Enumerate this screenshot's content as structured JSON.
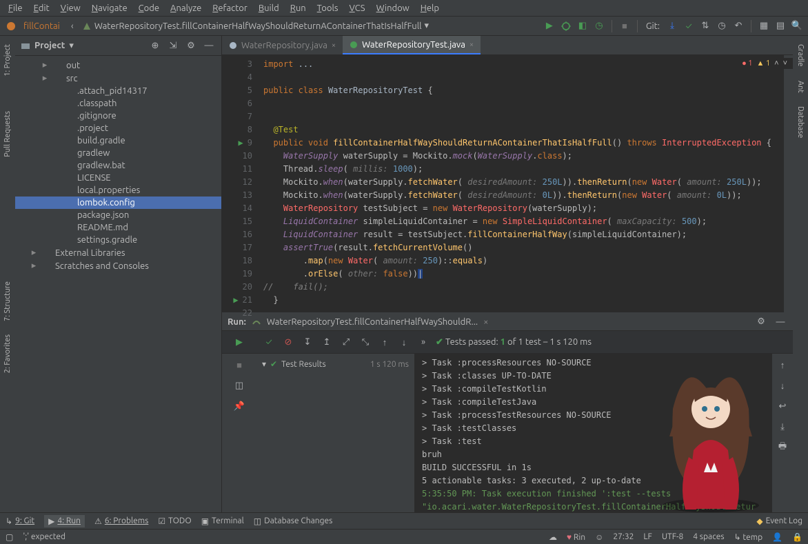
{
  "menu": [
    "File",
    "Edit",
    "View",
    "Navigate",
    "Code",
    "Analyze",
    "Refactor",
    "Build",
    "Run",
    "Tools",
    "VCS",
    "Window",
    "Help"
  ],
  "toolbar": {
    "run_config_short": "fillContai",
    "breadcrumb": "WaterRepositoryTest.fillContainerHalfWayShouldReturnAContainerThatIsHalfFull",
    "git_label": "Git:"
  },
  "left_tool_tabs": [
    "1: Project",
    "Pull Requests"
  ],
  "right_tool_tabs": [
    "Gradle",
    "Ant",
    "Database"
  ],
  "project": {
    "title": "Project",
    "items": [
      {
        "label": "out",
        "indent": 2,
        "exp": "▸",
        "icon": "folder"
      },
      {
        "label": "src",
        "indent": 2,
        "exp": "▸",
        "icon": "folder-src"
      },
      {
        "label": ".attach_pid14317",
        "indent": 3,
        "icon": "file"
      },
      {
        "label": ".classpath",
        "indent": 3,
        "icon": "eclipse"
      },
      {
        "label": ".gitignore",
        "indent": 3,
        "icon": "file"
      },
      {
        "label": ".project",
        "indent": 3,
        "icon": "eclipse"
      },
      {
        "label": "build.gradle",
        "indent": 3,
        "icon": "gradle"
      },
      {
        "label": "gradlew",
        "indent": 3,
        "icon": "file"
      },
      {
        "label": "gradlew.bat",
        "indent": 3,
        "icon": "file"
      },
      {
        "label": "LICENSE",
        "indent": 3,
        "icon": "file"
      },
      {
        "label": "local.properties",
        "indent": 3,
        "icon": "props"
      },
      {
        "label": "lombok.config",
        "indent": 3,
        "icon": "file",
        "sel": true
      },
      {
        "label": "package.json",
        "indent": 3,
        "icon": "json"
      },
      {
        "label": "README.md",
        "indent": 3,
        "icon": "md"
      },
      {
        "label": "settings.gradle",
        "indent": 3,
        "icon": "gradle"
      },
      {
        "label": "External Libraries",
        "indent": 1,
        "exp": "▸",
        "icon": "lib"
      },
      {
        "label": "Scratches and Consoles",
        "indent": 1,
        "exp": "▸",
        "icon": "scratch"
      }
    ]
  },
  "editor": {
    "tabs": [
      {
        "label": "WaterRepository.java",
        "active": false
      },
      {
        "label": "WaterRepositoryTest.java",
        "active": true
      }
    ],
    "errors": "1",
    "warnings": "1",
    "first_line_no": 3,
    "lines": [
      {
        "html": "<span class='kw'>import</span> <span class='type'>...</span>"
      },
      {
        "html": ""
      },
      {
        "html": "<span class='kw'>public class</span> <span class='cls'>WaterRepositoryTest</span> {"
      },
      {
        "html": ""
      },
      {
        "html": ""
      },
      {
        "html": "  <span class='an'>@Test</span>"
      },
      {
        "html": "  <span class='kw'>public void</span> <span class='fn'>fillContainerHalfWayShouldReturnAContainerThatIsHalfFull</span>() <span class='kw'>throws</span> <span class='err'>InterruptedException</span> {",
        "run": true
      },
      {
        "html": "    <span class='it'>WaterSupply</span> waterSupply = Mockito.<span class='it'>mock</span>(<span class='it'>WaterSupply</span>.<span class='kw'>class</span>);"
      },
      {
        "html": "    Thread.<span class='it'>sleep</span>( <span class='hint'>millis:</span> <span class='num'>1000</span>);"
      },
      {
        "html": "    Mockito.<span class='it'>when</span>(waterSupply.<span class='fn'>fetchWater</span>( <span class='hint'>desiredAmount:</span> <span class='num'>250L</span>)).<span class='fn'>thenReturn</span>(<span class='kw'>new</span> <span class='err'>Water</span>( <span class='hint'>amount:</span> <span class='num'>250L</span>));"
      },
      {
        "html": "    Mockito.<span class='it'>when</span>(waterSupply.<span class='fn'>fetchWater</span>( <span class='hint'>desiredAmount:</span> <span class='num'>0L</span>)).<span class='fn'>thenReturn</span>(<span class='kw'>new</span> <span class='err'>Water</span>( <span class='hint'>amount:</span> <span class='num'>0L</span>));"
      },
      {
        "html": "    <span class='err'>WaterRepository</span> testSubject = <span class='kw'>new</span> <span class='err'>WaterRepository</span>(waterSupply);"
      },
      {
        "html": "    <span class='it'>LiquidContainer</span> simpleLiquidContainer = <span class='kw'>new</span> <span class='err'>SimpleLiquidContainer</span>( <span class='hint'>maxCapacity:</span> <span class='num'>500</span>);"
      },
      {
        "html": "    <span class='it'>LiquidContainer</span> result = testSubject.<span class='fn'>fillContainerHalfWay</span>(simpleLiquidContainer);"
      },
      {
        "html": "    <span class='it'>assertTrue</span>(result.<span class='fn'>fetchCurrentVolume</span>()"
      },
      {
        "html": "        .<span class='fn'>map</span>(<span class='kw'>new</span> <span class='err'>Water</span>( <span class='hint'>amount:</span> <span class='num'>250</span>)::<span class='fn'>equals</span>)"
      },
      {
        "html": "        .<span class='fn'>orElse</span>( <span class='hint'>other:</span> <span class='kw'>false</span>))<span style='background:#214283;'>|</span>"
      },
      {
        "html": "<span class='cm'>//    fail();</span>"
      },
      {
        "html": "  }",
        "run": true
      },
      {
        "html": ""
      }
    ]
  },
  "run": {
    "title": "Run:",
    "crumb": "WaterRepositoryTest.fillContainerHalfWayShouldR...",
    "summary_pre": "Tests passed:",
    "summary_pass": "1",
    "summary_post": "of 1 test – 1 s 120 ms",
    "tree_root": "Test Results",
    "tree_time": "1 s 120 ms",
    "console": [
      "> Task :processResources NO-SOURCE",
      "> Task :classes UP-TO-DATE",
      "> Task :compileTestKotlin",
      "> Task :compileTestJava",
      "> Task :processTestResources NO-SOURCE",
      "> Task :testClasses",
      "> Task :test",
      "bruh",
      "BUILD SUCCESSFUL in 1s",
      "5 actionable tasks: 3 executed, 2 up-to-date"
    ],
    "console_time": "5:35:50 PM: Task execution finished ':test --tests \"io.acari.water.WaterRepositoryTest.fillContainerHalfWayShouldRetur"
  },
  "bottom_tabs": {
    "git": "9: Git",
    "run": "4: Run",
    "problems": "6: Problems",
    "todo": "TODO",
    "terminal": "Terminal",
    "db": "Database Changes",
    "eventlog": "Event Log"
  },
  "status": {
    "err": "';' expected",
    "user": "Rin",
    "pos": "27:32",
    "lf": "LF",
    "enc": "UTF-8",
    "indent": "4 spaces",
    "temp": "temp"
  },
  "left_stripe_tabs": [
    "7: Structure",
    "2: Favorites"
  ]
}
